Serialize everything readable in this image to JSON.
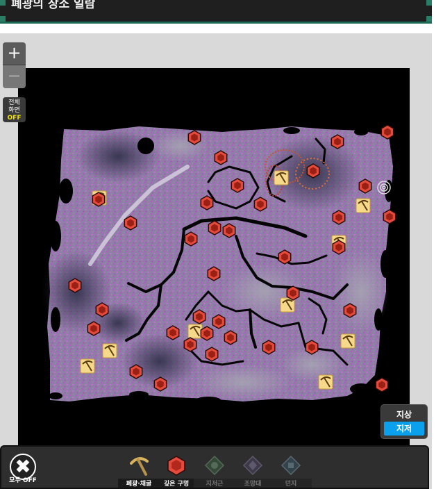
{
  "header": {
    "title": "폐광의 장소 일람"
  },
  "controls": {
    "zoom_in": "+",
    "zoom_out": "−",
    "fullscreen_label_1": "전체",
    "fullscreen_label_2": "화면",
    "fullscreen_state": "OFF",
    "layer_label": "지상",
    "layer_option": "지저"
  },
  "legend": {
    "all_off_label": "모두 OFF",
    "all_off_glyph": "✖",
    "items": [
      {
        "label": "폐광·채굴",
        "icon": "pickaxe-icon",
        "active": true
      },
      {
        "label": "깊은 구멍",
        "icon": "chasm-hexagon-icon",
        "active": true
      },
      {
        "label": "지저근",
        "icon": "lightroot-icon",
        "active": false
      },
      {
        "label": "조망대",
        "icon": "lookout-icon",
        "active": false
      },
      {
        "label": "던지",
        "icon": "shrine-icon",
        "active": false
      }
    ]
  },
  "colors": {
    "chasm_fill": "#e54b3c",
    "chasm_inner": "#d23a2c",
    "mine_fill": "#f7d98b",
    "layer_active": "#0aa0ec",
    "header_border": "#1d6b57"
  },
  "map": {
    "chasm_markers": [
      [
        280,
        198
      ],
      [
        318,
        227
      ],
      [
        486,
        204
      ],
      [
        558,
        190
      ],
      [
        451,
        246
      ],
      [
        342,
        267
      ],
      [
        526,
        268
      ],
      [
        142,
        287
      ],
      [
        298,
        292
      ],
      [
        375,
        294
      ],
      [
        188,
        321
      ],
      [
        488,
        313
      ],
      [
        561,
        312
      ],
      [
        309,
        328
      ],
      [
        330,
        332
      ],
      [
        275,
        344
      ],
      [
        488,
        356
      ],
      [
        410,
        370
      ],
      [
        308,
        394
      ],
      [
        108,
        411
      ],
      [
        422,
        422
      ],
      [
        147,
        446
      ],
      [
        504,
        447
      ],
      [
        287,
        456
      ],
      [
        315,
        463
      ],
      [
        135,
        473
      ],
      [
        249,
        479
      ],
      [
        298,
        480
      ],
      [
        332,
        486
      ],
      [
        274,
        496
      ],
      [
        387,
        500
      ],
      [
        449,
        500
      ],
      [
        305,
        510
      ],
      [
        196,
        535
      ],
      [
        231,
        553
      ],
      [
        550,
        554
      ]
    ],
    "mine_markers": [
      [
        143,
        285
      ],
      [
        405,
        256
      ],
      [
        523,
        296
      ],
      [
        488,
        349
      ],
      [
        414,
        439
      ],
      [
        281,
        477
      ],
      [
        158,
        505
      ],
      [
        501,
        491
      ],
      [
        126,
        527
      ],
      [
        469,
        550
      ]
    ]
  }
}
